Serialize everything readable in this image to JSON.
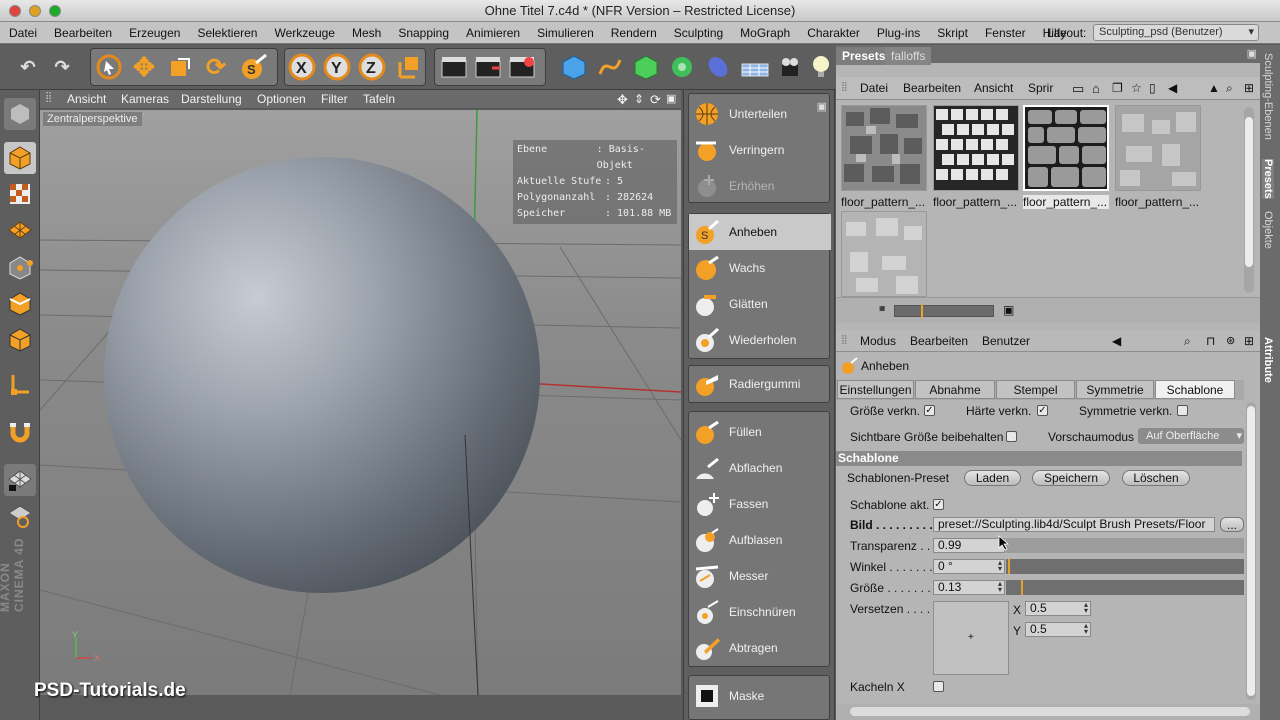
{
  "window": {
    "title": "Ohne Titel 7.c4d * (NFR Version – Restricted License)"
  },
  "menu": {
    "items": [
      "Datei",
      "Bearbeiten",
      "Erzeugen",
      "Selektieren",
      "Werkzeuge",
      "Mesh",
      "Snapping",
      "Animieren",
      "Simulieren",
      "Rendern",
      "Sculpting",
      "MoGraph",
      "Charakter",
      "Plug-ins",
      "Skript",
      "Fenster",
      "Hilfe"
    ],
    "layout_label": "Layout:",
    "layout_value": "Sculpting_psd (Benutzer)"
  },
  "viewport": {
    "menu": [
      "Ansicht",
      "Kameras",
      "Darstellung",
      "Optionen",
      "Filter",
      "Tafeln"
    ],
    "camera": "Zentralperspektive",
    "hud": [
      {
        "key": "Ebene",
        "value": ": Basis-Objekt"
      },
      {
        "key": "Aktuelle Stufe",
        "value": ": 5"
      },
      {
        "key": "Polygonanzahl",
        "value": ": 282624"
      },
      {
        "key": "Speicher",
        "value": ": 101.88 MB"
      }
    ],
    "axis_y": "Y",
    "axis_x": "X",
    "watermark": "PSD-Tutorials.de",
    "brand": "MAXON CINEMA 4D"
  },
  "brushes": {
    "group1": [
      "Unterteilen",
      "Verringern",
      "Erhöhen"
    ],
    "group2": [
      "Anheben",
      "Wachs",
      "Glätten",
      "Wiederholen"
    ],
    "group3": [
      "Radiergummi"
    ],
    "group4": [
      "Füllen",
      "Abflachen",
      "Fassen",
      "Aufblasen",
      "Messer",
      "Einschnüren",
      "Abtragen"
    ],
    "group5": [
      "Maske"
    ]
  },
  "presets": {
    "tabs": [
      "Presets",
      "falloffs"
    ],
    "menu": [
      "Datei",
      "Bearbeiten",
      "Ansicht",
      "Sprir"
    ],
    "thumbnails": [
      "floor_pattern_...",
      "floor_pattern_...",
      "floor_pattern_...",
      "floor_pattern_...",
      ""
    ]
  },
  "attributes": {
    "menu": [
      "Modus",
      "Bearbeiten",
      "Benutzer"
    ],
    "object": "Anheben",
    "tabs": [
      "Einstellungen",
      "Abnahme",
      "Stempel",
      "Symmetrie",
      "Schablone"
    ],
    "size_link": "Größe verkn.",
    "hardness_link": "Härte verkn.",
    "symmetry_link": "Symmetrie verkn.",
    "keep_visible_size": "Sichtbare Größe beibehalten",
    "preview_mode_label": "Vorschaumodus",
    "preview_mode_value": "Auf Oberfläche",
    "section": "Schablone",
    "preset_label": "Schablonen-Preset",
    "load": "Laden",
    "save": "Speichern",
    "delete": "Löschen",
    "stencil_active": "Schablone akt.",
    "image_label": "Bild . . . . . . . . . . .",
    "image_value": "preset://Sculpting.lib4d/Sculpt Brush Presets/Floor",
    "browse": "...",
    "transparency_label": "Transparenz . .",
    "transparency_value": "0.99",
    "angle_label": "Winkel . . . . . . . .",
    "angle_value": "0 °",
    "size_label": "Größe . . . . . . . .",
    "size_value": "0.13",
    "offset_label": "Versetzen . . . . .",
    "offset_x_label": "X",
    "offset_x_value": "0.5",
    "offset_y_label": "Y",
    "offset_y_value": "0.5",
    "tile_x": "Kacheln X"
  },
  "side_tabs": [
    "Sculpting-Ebenen",
    "Presets",
    "Objekte",
    "Attribute"
  ]
}
